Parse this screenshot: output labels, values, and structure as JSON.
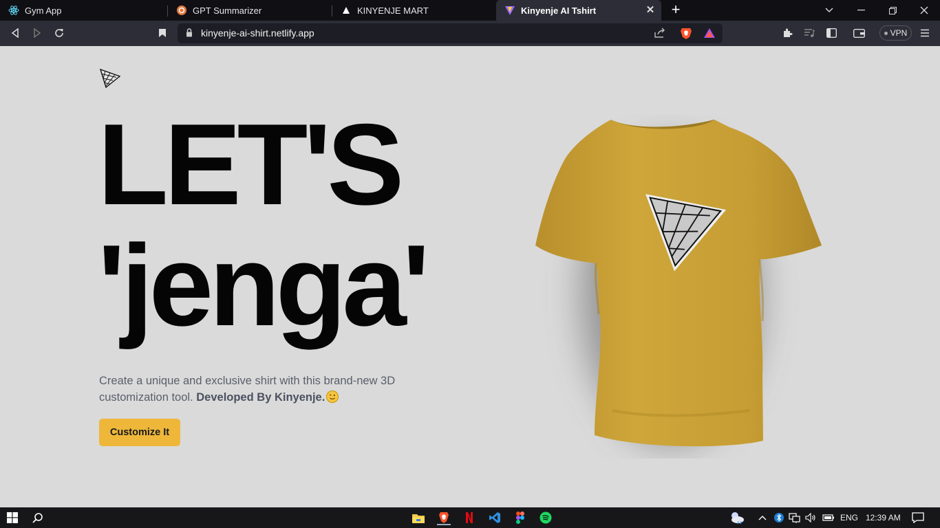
{
  "browser": {
    "tabs": [
      {
        "title": "Gym App",
        "icon": "react-icon",
        "active": false
      },
      {
        "title": "GPT Summarizer",
        "icon": "openai-icon",
        "active": false
      },
      {
        "title": "KINYENJE MART",
        "icon": "triangle-icon",
        "active": false
      },
      {
        "title": "Kinyenje AI Tshirt",
        "icon": "vite-icon",
        "active": true
      }
    ],
    "url": "kinyenje-ai-shirt.netlify.app",
    "vpn_label": "VPN"
  },
  "page": {
    "hero_line1": "LET'S",
    "hero_line2": "'jenga'",
    "description": "Create a unique and exclusive shirt with this brand-new 3D customization tool.",
    "description_bold": "Developed By Kinyenje.",
    "cta_label": "Customize It",
    "shirt_color": "#c9a23a",
    "accent_color": "#eeb73a"
  },
  "taskbar": {
    "apps": [
      "file-explorer-icon",
      "brave-icon",
      "netflix-icon",
      "vscode-icon",
      "figma-icon",
      "spotify-icon"
    ],
    "language": "ENG",
    "time": "12:39 AM"
  }
}
